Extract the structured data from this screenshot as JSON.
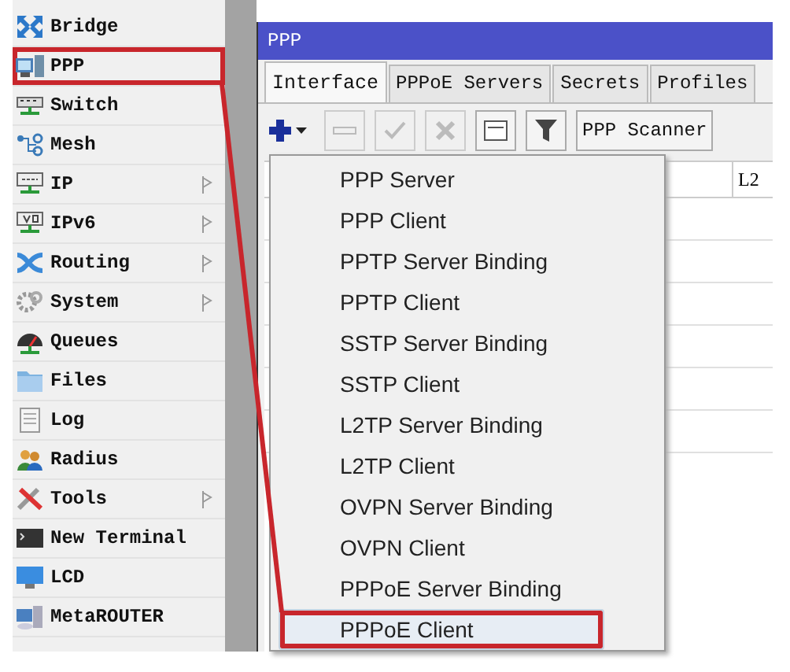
{
  "sidebar": {
    "items": [
      {
        "label": "Bridge",
        "has_submenu": false,
        "annotated": false
      },
      {
        "label": "PPP",
        "has_submenu": false,
        "annotated": true
      },
      {
        "label": "Switch",
        "has_submenu": false,
        "annotated": false
      },
      {
        "label": "Mesh",
        "has_submenu": false,
        "annotated": false
      },
      {
        "label": "IP",
        "has_submenu": true,
        "annotated": false
      },
      {
        "label": "IPv6",
        "has_submenu": true,
        "annotated": false
      },
      {
        "label": "Routing",
        "has_submenu": true,
        "annotated": false
      },
      {
        "label": "System",
        "has_submenu": true,
        "annotated": false
      },
      {
        "label": "Queues",
        "has_submenu": false,
        "annotated": false
      },
      {
        "label": "Files",
        "has_submenu": false,
        "annotated": false
      },
      {
        "label": "Log",
        "has_submenu": false,
        "annotated": false
      },
      {
        "label": "Radius",
        "has_submenu": false,
        "annotated": false
      },
      {
        "label": "Tools",
        "has_submenu": true,
        "annotated": false
      },
      {
        "label": "New Terminal",
        "has_submenu": false,
        "annotated": false
      },
      {
        "label": "LCD",
        "has_submenu": false,
        "annotated": false
      },
      {
        "label": "MetaROUTER",
        "has_submenu": false,
        "annotated": false
      }
    ]
  },
  "window": {
    "title": "PPP",
    "tabs": [
      {
        "label": "Interface",
        "selected": true
      },
      {
        "label": "PPPoE Servers",
        "selected": false
      },
      {
        "label": "Secrets",
        "selected": false
      },
      {
        "label": "Profiles",
        "selected": false
      }
    ],
    "toolbar": [
      {
        "kind": "add"
      },
      {
        "kind": "remove",
        "disabled": true
      },
      {
        "kind": "enable",
        "disabled": true
      },
      {
        "kind": "disable",
        "disabled": true
      },
      {
        "kind": "comment",
        "disabled": false
      },
      {
        "kind": "filter",
        "disabled": false
      },
      {
        "kind": "text",
        "label": "PPP Scanner",
        "disabled": false
      }
    ],
    "table": {
      "columns": [
        "L2"
      ]
    },
    "add_menu": {
      "items": [
        {
          "label": "PPP Server",
          "selected": false,
          "annotated": false
        },
        {
          "label": "PPP Client",
          "selected": false,
          "annotated": false
        },
        {
          "label": "PPTP Server Binding",
          "selected": false,
          "annotated": false
        },
        {
          "label": "PPTP Client",
          "selected": false,
          "annotated": false
        },
        {
          "label": "SSTP Server Binding",
          "selected": false,
          "annotated": false
        },
        {
          "label": "SSTP Client",
          "selected": false,
          "annotated": false
        },
        {
          "label": "L2TP Server Binding",
          "selected": false,
          "annotated": false
        },
        {
          "label": "L2TP Client",
          "selected": false,
          "annotated": false
        },
        {
          "label": "OVPN Server Binding",
          "selected": false,
          "annotated": false
        },
        {
          "label": "OVPN Client",
          "selected": false,
          "annotated": false
        },
        {
          "label": "PPPoE Server Binding",
          "selected": false,
          "annotated": false
        },
        {
          "label": "PPPoE Client",
          "selected": true,
          "annotated": true
        }
      ]
    }
  }
}
